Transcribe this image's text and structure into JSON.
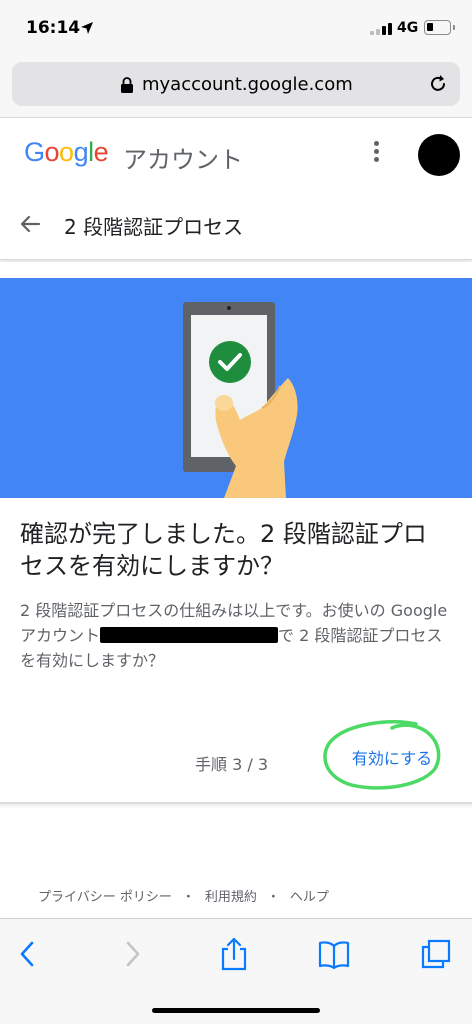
{
  "status_bar": {
    "time": "16:14",
    "network": "4G",
    "battery_level": 0.3
  },
  "browser": {
    "url": "myaccount.google.com",
    "icons": [
      "lock-icon",
      "reload-icon",
      "back-icon",
      "forward-icon",
      "share-icon",
      "bookmarks-icon",
      "tabs-icon"
    ]
  },
  "header": {
    "logo_letters": [
      "G",
      "o",
      "o",
      "g",
      "l",
      "e"
    ],
    "logo_colors": [
      "#4285f4",
      "#ea4335",
      "#fbbc05",
      "#4285f4",
      "#34a853",
      "#ea4335"
    ],
    "account_label": "アカウント"
  },
  "page": {
    "title": "2 段階認証プロセス"
  },
  "card": {
    "question": "確認が完了しました。2 段階認証プロセスを有効にしますか？",
    "description_before": "2 段階認証プロセスの仕組みは以上です。お使いの Google アカウント",
    "description_after": "で 2 段階認証プロセスを有効にしますか？",
    "step": "手順 3 / 3",
    "enable_label": "有効にする"
  },
  "footer": {
    "privacy": "プライバシー ポリシー",
    "terms": "利用規約",
    "help": "ヘルプ",
    "separator": "・"
  },
  "colors": {
    "hero_bg": "#4285f4",
    "accent": "#1a73e8",
    "check_green": "#1e8e3e",
    "annotation_green": "#4cd964"
  }
}
